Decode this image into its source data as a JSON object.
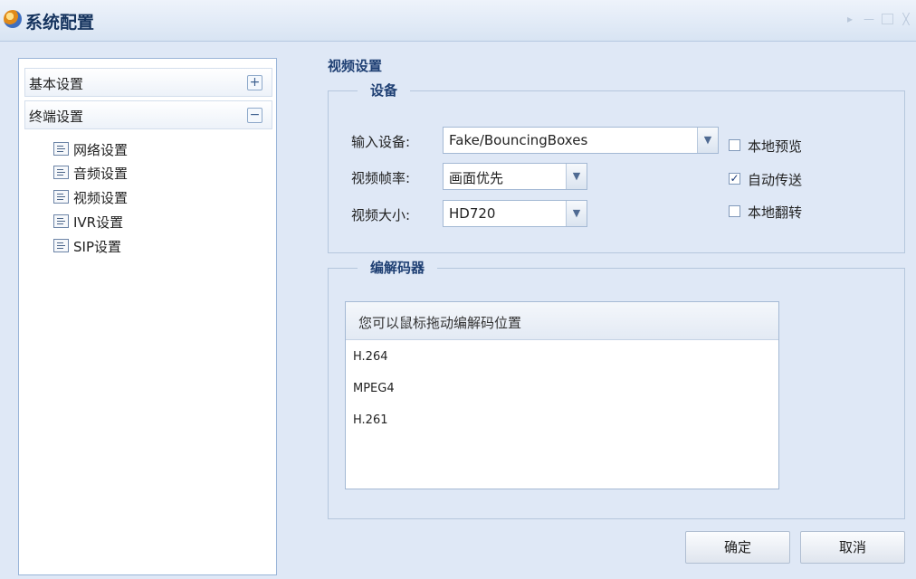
{
  "window": {
    "title": "系统配置"
  },
  "nav": {
    "groups": [
      {
        "label": "基本设置",
        "toggle": "+"
      },
      {
        "label": "终端设置",
        "toggle": "−"
      }
    ],
    "items": [
      {
        "label": "网络设置"
      },
      {
        "label": "音频设置"
      },
      {
        "label": "视频设置"
      },
      {
        "label": "IVR设置"
      },
      {
        "label": "SIP设置"
      }
    ],
    "selected": "视频设置"
  },
  "content": {
    "section_title": "视频设置",
    "device": {
      "legend": "设备",
      "input_device_label": "输入设备:",
      "input_device_value": "Fake/BouncingBoxes",
      "frame_rate_label": "视频帧率:",
      "frame_rate_value": "画面优先",
      "video_size_label": "视频大小:",
      "video_size_value": "HD720",
      "checkboxes": [
        {
          "label": "本地预览",
          "checked": false
        },
        {
          "label": "自动传送",
          "checked": true
        },
        {
          "label": "本地翻转",
          "checked": false
        }
      ]
    },
    "codec": {
      "legend": "编解码器",
      "header": "您可以鼠标拖动编解码位置",
      "items": [
        "H.264",
        "MPEG4",
        "H.261"
      ]
    }
  },
  "buttons": {
    "ok": "确定",
    "cancel": "取消"
  },
  "colors": {
    "accent": "#1e3f73",
    "background": "#dfe8f6",
    "border": "#99b4d8"
  }
}
